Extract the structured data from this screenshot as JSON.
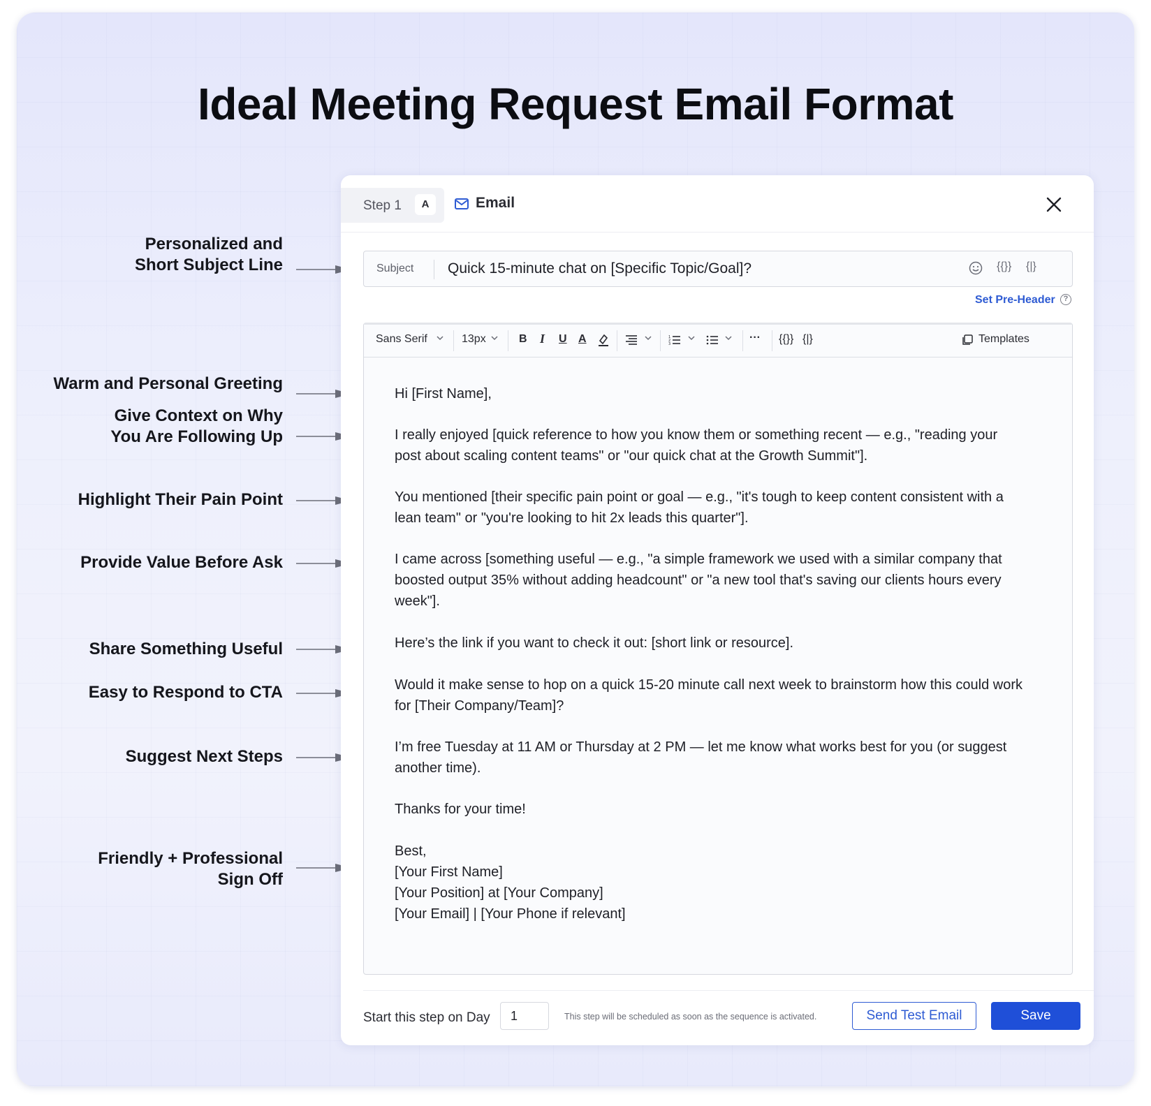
{
  "page": {
    "title": "Ideal Meeting Request Email Format"
  },
  "annotations": [
    {
      "lines": [
        "Personalized and",
        "Short Subject Line"
      ]
    },
    {
      "lines": [
        "Warm and Personal Greeting"
      ]
    },
    {
      "lines": [
        "Give Context on Why",
        "You Are Following Up"
      ]
    },
    {
      "lines": [
        "Highlight Their Pain Point"
      ]
    },
    {
      "lines": [
        "Provide Value Before Ask"
      ]
    },
    {
      "lines": [
        "Share Something Useful"
      ]
    },
    {
      "lines": [
        "Easy to Respond to CTA"
      ]
    },
    {
      "lines": [
        "Suggest Next Steps"
      ]
    },
    {
      "lines": [
        "Friendly + Professional",
        "Sign Off"
      ]
    }
  ],
  "modal": {
    "step_label": "Step 1",
    "step_badge": "A",
    "channel_label": "Email",
    "subject": {
      "label": "Subject",
      "value": "Quick 15-minute chat on [Specific Topic/Goal]?",
      "icons": [
        "smiley-icon",
        "variable-braces-icon",
        "snippet-braces-icon"
      ],
      "icon_glyphs": {
        "variables": "{{}}",
        "snippets": "{|}"
      }
    },
    "pre_header_link": "Set Pre-Header",
    "toolbar": {
      "font_family": "Sans Serif",
      "font_size": "13px",
      "bold": "B",
      "italic": "I",
      "underline": "U",
      "text_color": "A",
      "more": "···",
      "variables": "{{}}",
      "snippets": "{|}",
      "templates": "Templates"
    },
    "body": [
      [
        "Hi [First Name],"
      ],
      [
        "I really enjoyed [quick reference to how you know them or something recent — e.g., \"reading your",
        "post about scaling content teams\" or \"our quick chat at the Growth Summit\"]."
      ],
      [
        "You mentioned [their specific pain point or goal — e.g., \"it's tough to keep content consistent with a",
        "lean team\" or \"you're looking to hit 2x leads this quarter\"]."
      ],
      [
        "I came across [something useful — e.g., \"a simple framework we used with a similar company that",
        "boosted output 35% without adding headcount\" or \"a new tool that's saving our clients hours every",
        "week\"]."
      ],
      [
        "Here’s the link if you want to check it out: [short link or resource]."
      ],
      [
        "Would it make sense to hop on a quick 15-20 minute call next week to brainstorm how this could work",
        "for [Their Company/Team]?"
      ],
      [
        "I’m free Tuesday at 11 AM or Thursday at 2 PM — let me know what works best for you (or suggest",
        "another time)."
      ],
      [
        "Thanks for your time!"
      ],
      [
        "Best,",
        "[Your First Name]",
        "[Your Position] at [Your Company]",
        "[Your Email] | [Your Phone if relevant]"
      ]
    ],
    "footer": {
      "start_label": "Start this step on Day",
      "day_value": "1",
      "schedule_note": "This step will be scheduled as soon as the sequence is activated.",
      "send_test_label": "Send Test Email",
      "save_label": "Save"
    }
  },
  "colors": {
    "accent": "#1f4fd8",
    "link": "#2e5bd3",
    "arrow": "#6b6d78",
    "title": "#0c0d12"
  }
}
